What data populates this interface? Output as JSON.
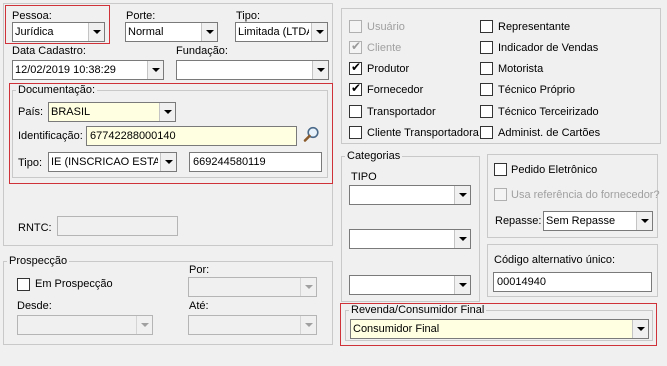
{
  "pessoa": {
    "label": "Pessoa:",
    "value": "Jurídica"
  },
  "porte": {
    "label": "Porte:",
    "value": "Normal"
  },
  "tipo_empresa": {
    "label": "Tipo:",
    "value": "Limitada (LTDA"
  },
  "data_cadastro": {
    "label": "Data Cadastro:",
    "value": "12/02/2019 10:38:29"
  },
  "fundacao": {
    "label": "Fundação:",
    "value": ""
  },
  "documentacao": {
    "title": "Documentação:",
    "pais_label": "País:",
    "pais_value": "BRASIL",
    "identificacao_label": "Identificação:",
    "identificacao_value": "67742288000140",
    "tipo_label": "Tipo:",
    "tipo_value": "IE (INSCRICAO ESTAD",
    "tipo_number": "669244580119"
  },
  "rntc": {
    "label": "RNTC:",
    "value": ""
  },
  "prospeccao": {
    "title": "Prospecção",
    "em_prospeccao": "Em Prospecção",
    "por_label": "Por:",
    "desde_label": "Desde:",
    "ate_label": "Até:"
  },
  "roles_left": [
    {
      "label": "Usuário",
      "checked": false,
      "disabled": true
    },
    {
      "label": "Cliente",
      "checked": true,
      "disabled": true
    },
    {
      "label": "Produtor",
      "checked": true,
      "disabled": false
    },
    {
      "label": "Fornecedor",
      "checked": true,
      "disabled": false
    },
    {
      "label": "Transportador",
      "checked": false,
      "disabled": false
    },
    {
      "label": "Cliente Transportadora",
      "checked": false,
      "disabled": false
    }
  ],
  "roles_right": [
    {
      "label": "Representante",
      "checked": false
    },
    {
      "label": "Indicador de Vendas",
      "checked": false
    },
    {
      "label": "Motorista",
      "checked": false
    },
    {
      "label": "Técnico Próprio",
      "checked": false
    },
    {
      "label": "Técnico Terceirizado",
      "checked": false
    },
    {
      "label": "Administ. de Cartões",
      "checked": false
    }
  ],
  "categorias": {
    "title": "Categorias",
    "tipo_label": "TIPO"
  },
  "pedido": {
    "pedido_eletronico": "Pedido Eletrônico",
    "usa_referencia": "Usa referência do fornecedor?",
    "repasse_label": "Repasse:",
    "repasse_value": "Sem Repasse"
  },
  "codigo_alternativo": {
    "label": "Código alternativo único:",
    "value": "00014940"
  },
  "revenda": {
    "title": "Revenda/Consumidor Final",
    "value": "Consumidor Final"
  },
  "colors": {
    "highlight_border": "#d0323a",
    "field_yellow": "#ffffe1",
    "background": "#f0f0f0"
  },
  "icons": [
    "chevron-down-icon",
    "checkmark-icon",
    "magnifier-icon"
  ]
}
